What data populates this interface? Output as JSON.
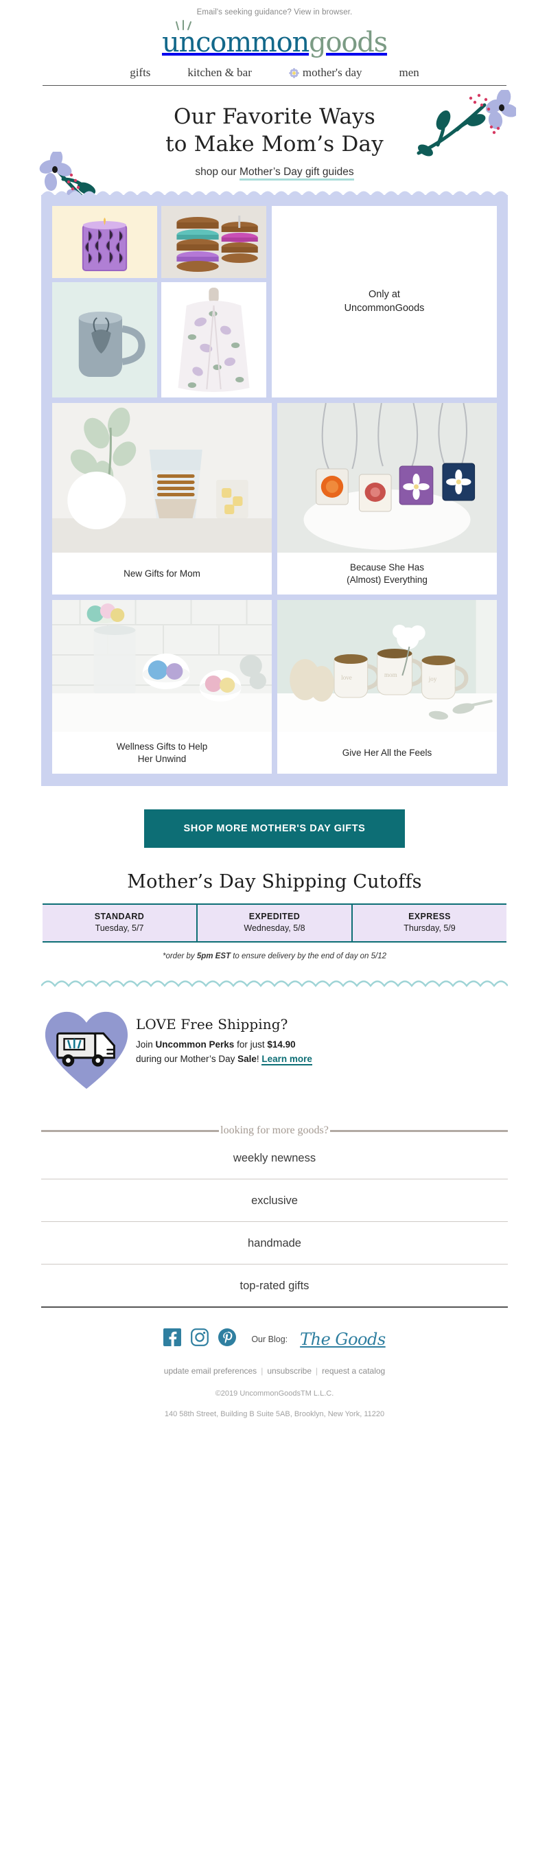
{
  "preheader": {
    "text": "Email's seeking guidance? View in browser."
  },
  "brand": {
    "logo_part1": "uncommon",
    "logo_part2": "goods",
    "color_teal": "#12688a",
    "color_green": "#7b9b84"
  },
  "nav": {
    "items": [
      {
        "label": "gifts",
        "icon": ""
      },
      {
        "label": "kitchen & bar",
        "icon": ""
      },
      {
        "label": "mother's day",
        "icon": "flower-icon"
      },
      {
        "label": "men",
        "icon": ""
      }
    ]
  },
  "hero": {
    "headline_line1": "Our Favorite Ways",
    "headline_line2": "to Make Mom’s Day",
    "sub_prefix": "shop our ",
    "sub_link": "Mother’s Day gift guides",
    "underline_color": "#a9ddd9"
  },
  "grid": {
    "panel_color": "#ccd3f0",
    "only_at_line1": "Only at",
    "only_at_line2": "UncommonGoods",
    "tiles": [
      {
        "caption": "New Gifts for Mom"
      },
      {
        "caption": "Because She Has\n(Almost) Everything"
      },
      {
        "caption": "Wellness Gifts to Help\nHer Unwind"
      },
      {
        "caption": "Give Her All the Feels"
      }
    ],
    "captions": {
      "new_gifts": "New Gifts for Mom",
      "because_l1": "Because She Has",
      "because_l2": "(Almost) Everything",
      "wellness_l1": "Wellness Gifts to Help",
      "wellness_l2": "Her Unwind",
      "feels": "Give Her All the Feels"
    }
  },
  "cta": {
    "label": "SHOP MORE MOTHER'S DAY GIFTS",
    "bg": "#0d6e75"
  },
  "shipping": {
    "title": "Mother’s Day Shipping Cutoffs",
    "columns": [
      {
        "tier": "STANDARD",
        "date": "Tuesday, 5/7"
      },
      {
        "tier": "EXPEDITED",
        "date": "Wednesday, 5/8"
      },
      {
        "tier": "EXPRESS",
        "date": "Thursday, 5/9"
      }
    ],
    "note_a": "*order by ",
    "note_b": "5pm EST",
    "note_c": " to ensure delivery by the end of day on 5/12",
    "border_color": "#0d6e75",
    "cell_bg": "#ece3f6"
  },
  "perks": {
    "heading": "LOVE Free Shipping?",
    "line1_a": "Join ",
    "line1_b": "Uncommon Perks",
    "line1_c": " for just ",
    "line1_d": "$14.90",
    "line2_a": "during our Mother’s Day ",
    "line2_b": "Sale",
    "line2_c": "! ",
    "link": "Learn more",
    "heart_color": "#9198cf"
  },
  "more": {
    "header": "looking for more goods?",
    "links": [
      {
        "label": "weekly newness"
      },
      {
        "label": "exclusive"
      },
      {
        "label": "handmade"
      },
      {
        "label": "top-rated gifts"
      }
    ]
  },
  "social": {
    "icons": [
      {
        "name": "facebook-icon"
      },
      {
        "name": "instagram-icon"
      },
      {
        "name": "pinterest-icon"
      }
    ],
    "blog_label": "Our Blog:",
    "blog_name": "The Goods",
    "color": "#2f7fa0"
  },
  "footer": {
    "link1": "update email preferences",
    "link2": "unsubscribe",
    "link3": "request a catalog",
    "copyright": "©2019 UncommonGoodsTM L.L.C.",
    "address": "140 58th Street, Building B Suite 5AB, Brooklyn, New York, 11220"
  }
}
